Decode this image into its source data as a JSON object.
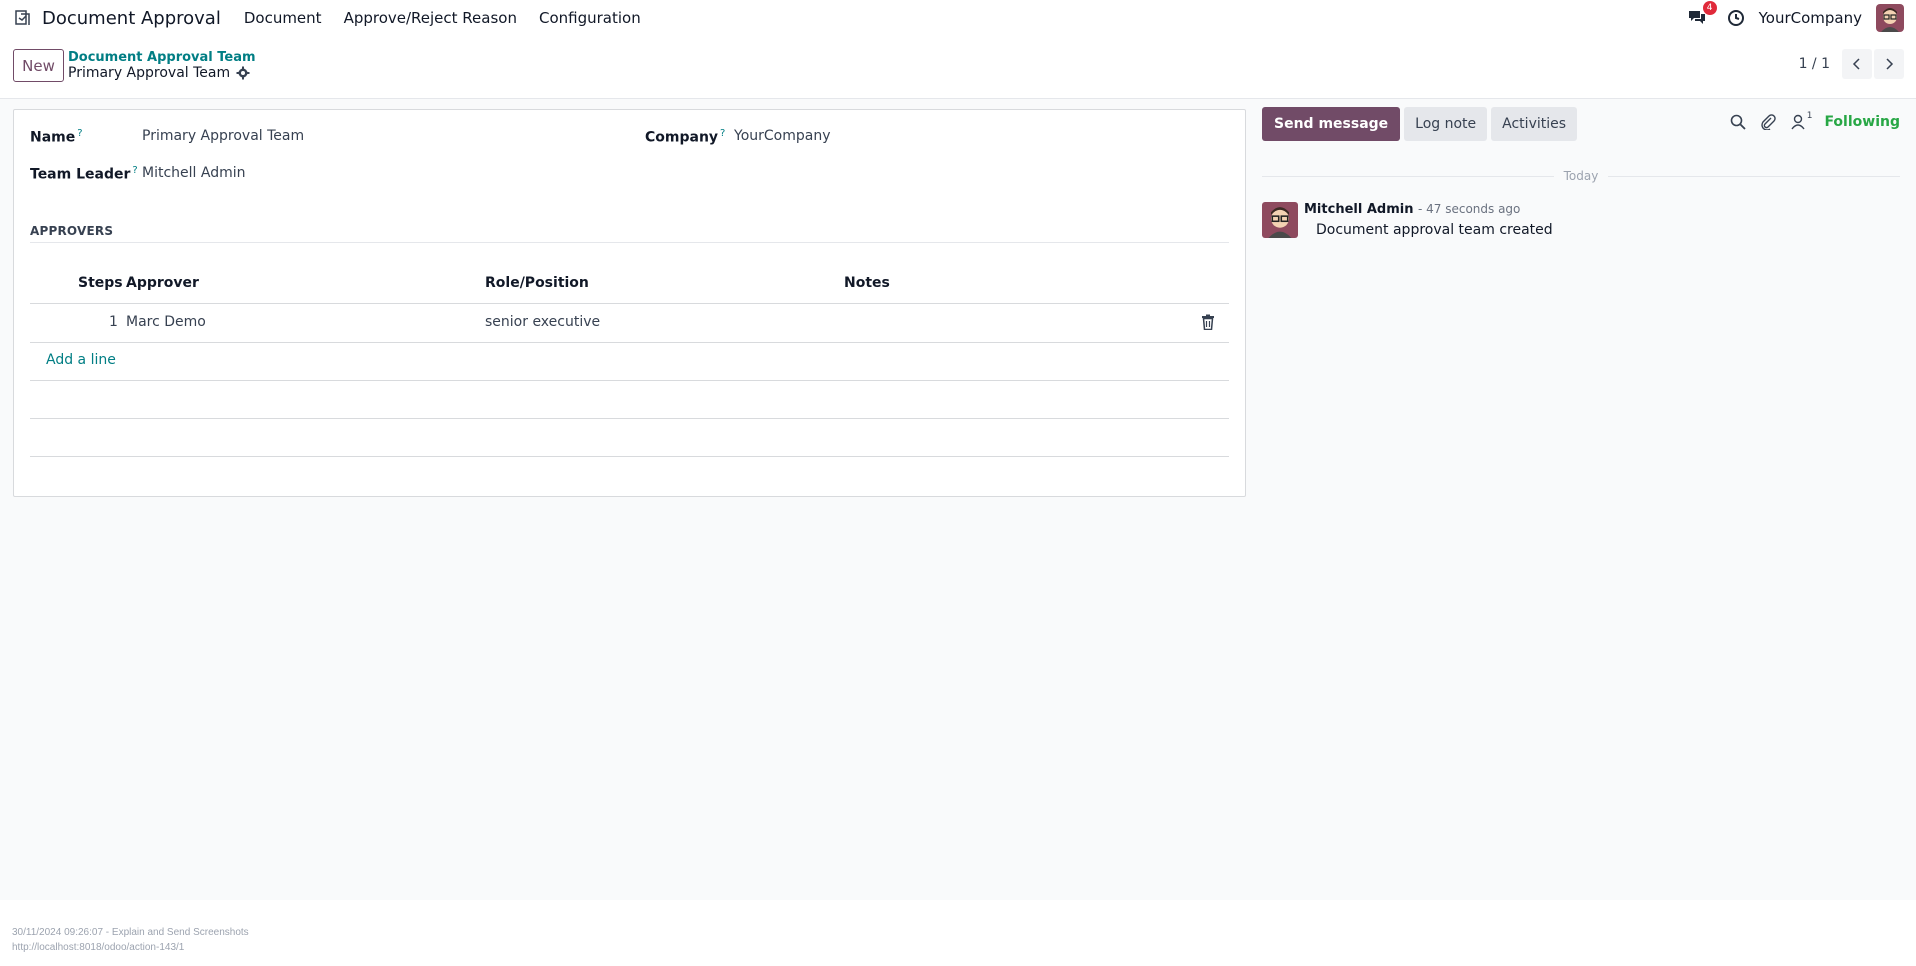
{
  "topbar": {
    "app_name": "Document Approval",
    "menu": [
      "Document",
      "Approve/Reject Reason",
      "Configuration"
    ],
    "chat_badge": "4",
    "company": "YourCompany"
  },
  "control": {
    "new_label": "New",
    "breadcrumb_parent": "Document Approval Team",
    "breadcrumb_current": "Primary Approval Team",
    "pager": "1 / 1"
  },
  "form": {
    "name_label": "Name",
    "name_value": "Primary Approval Team",
    "company_label": "Company",
    "company_value": "YourCompany",
    "leader_label": "Team Leader",
    "leader_value": "Mitchell Admin",
    "help_mark": "?",
    "section_title": "APPROVERS",
    "columns": [
      "Steps",
      "Approver",
      "Role/Position",
      "Notes"
    ],
    "rows": [
      {
        "steps": "1",
        "approver": "Marc Demo",
        "role": "senior executive",
        "notes": ""
      }
    ],
    "add_line": "Add a line"
  },
  "chatter": {
    "send_message": "Send message",
    "log_note": "Log note",
    "activities": "Activities",
    "follower_count": "1",
    "following": "Following",
    "date_separator": "Today",
    "message": {
      "author": "Mitchell Admin",
      "time": "- 47 seconds ago",
      "body": "Document approval team created"
    }
  },
  "footer": {
    "line1": "30/11/2024 09:26:07 - Explain and Send Screenshots",
    "line2": "http://localhost:8018/odoo/action-143/1"
  },
  "colors": {
    "brand": "#714b67",
    "link": "#017e84",
    "following": "#28a745",
    "badge": "#e02a3a"
  }
}
